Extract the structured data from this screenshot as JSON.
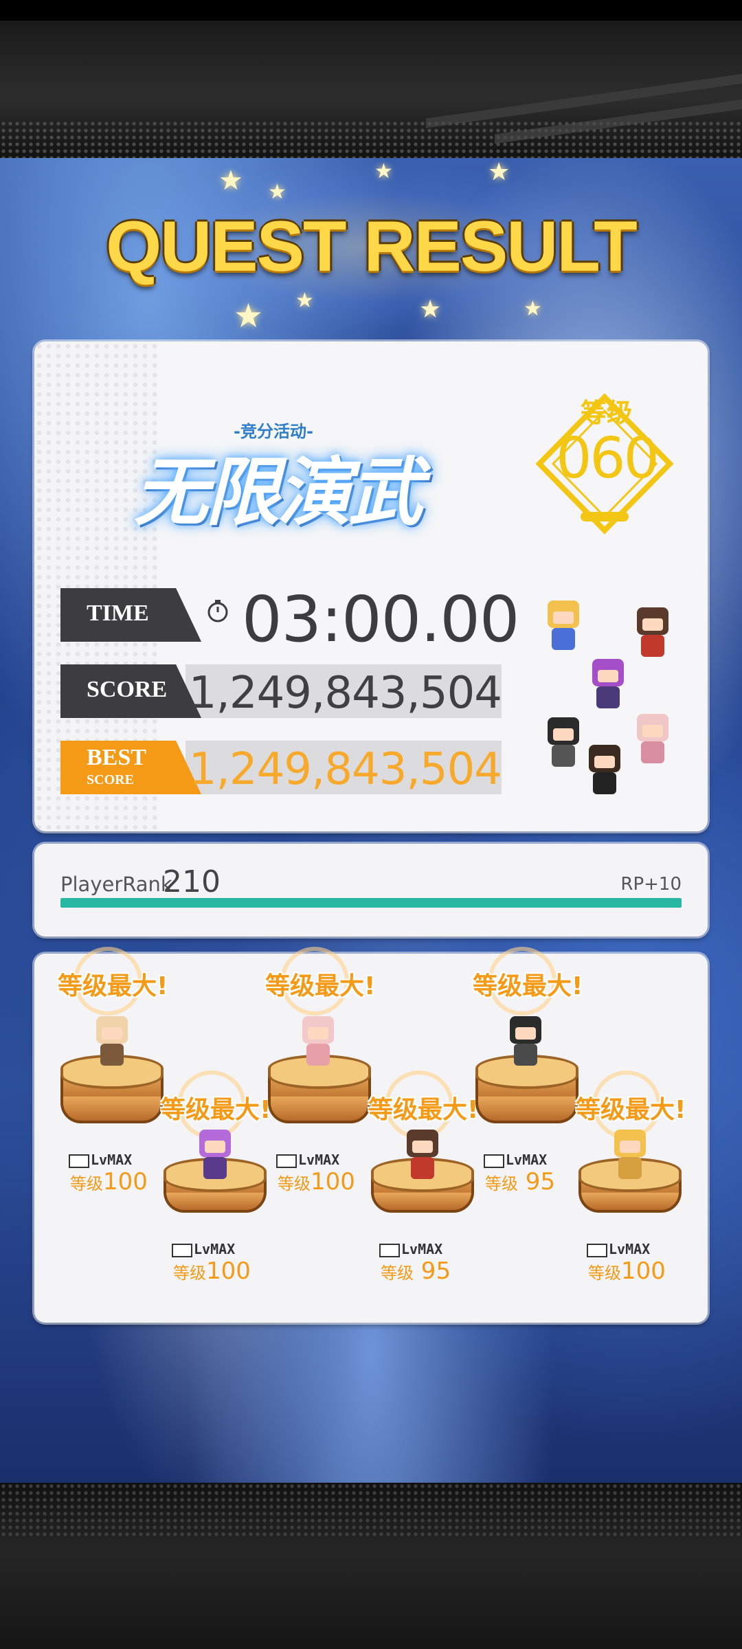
{
  "header": {
    "title": "QUEST RESULT"
  },
  "event": {
    "subtitle": "-竞分活动-",
    "name": "无限演武"
  },
  "level": {
    "label": "等级",
    "value": "060"
  },
  "stats": {
    "time_label": "TIME",
    "time_value": "03:00.00",
    "score_label": "SCORE",
    "score_value": "1,249,843,504",
    "best_label": "BEST",
    "best_sublabel": "SCORE",
    "best_value": "1,249,843,504"
  },
  "player": {
    "rank_label": "PlayerRank",
    "rank_value": "210",
    "rp_gain": "RP+10",
    "progress_fraction": 1.0
  },
  "units": [
    {
      "max_text": "等级最大!",
      "badge": "LvMAX",
      "level_prefix": "等级",
      "level": "100"
    },
    {
      "max_text": "等级最大!",
      "badge": "LvMAX",
      "level_prefix": "等级",
      "level": "100"
    },
    {
      "max_text": "等级最大!",
      "badge": "LvMAX",
      "level_prefix": "等级",
      "level": "100"
    },
    {
      "max_text": "等级最大!",
      "badge": "LvMAX",
      "level_prefix": "等级",
      "level": " 95"
    },
    {
      "max_text": "等级最大!",
      "badge": "LvMAX",
      "level_prefix": "等级",
      "level": " 95"
    },
    {
      "max_text": "等级最大!",
      "badge": "LvMAX",
      "level_prefix": "等级",
      "level": "100"
    }
  ],
  "colors": {
    "accent_orange": "#f49a17",
    "title_gold": "#ffd84a",
    "level_gold": "#f3c614",
    "rank_bar": "#27b7a3",
    "label_dark": "#3d3d3f"
  }
}
